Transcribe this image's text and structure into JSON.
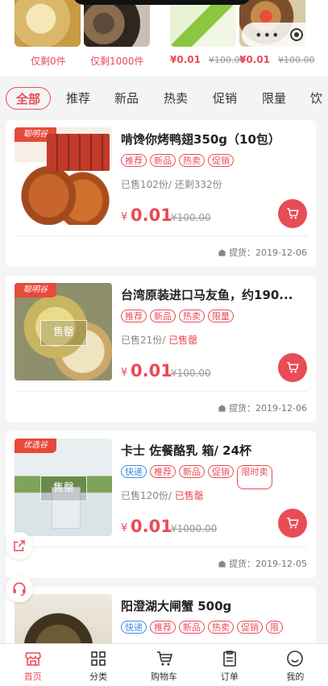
{
  "top_strip": {
    "items": [
      {
        "text": "仅剩0件"
      },
      {
        "text": "仅剩1000件"
      },
      {
        "price": "¥0.01",
        "orig": "¥100.00"
      },
      {
        "price": "¥0.01",
        "orig": "¥100.00"
      }
    ]
  },
  "tabs": [
    "全部",
    "推荐",
    "新品",
    "热卖",
    "促销",
    "限量",
    "饮"
  ],
  "products": [
    {
      "badge": "聪明谷",
      "name": "啃馋你烤鸭翅350g（10包）",
      "tags": [
        "推荐",
        "新品",
        "热卖",
        "促销"
      ],
      "sold": "已售102份/ 还剩332份",
      "price_symbol": "¥",
      "price": "0.01",
      "orig_price": "¥100.00",
      "pickup": "提货：2019-12-06"
    },
    {
      "badge": "聪明谷",
      "overlay": "售罄",
      "name": "台湾原装进口马友鱼，约190...",
      "tags": [
        "推荐",
        "新品",
        "热卖",
        "限量"
      ],
      "sold_prefix": "已售21份/ ",
      "sold_status": "已售罄",
      "price_symbol": "¥",
      "price": "0.01",
      "orig_price": "¥100.00",
      "pickup": "提货：2019-12-06"
    },
    {
      "badge": "优选谷",
      "overlay": "售罄",
      "name": "卡士 佐餐酪乳 箱/ 24杯",
      "tags": [
        "快递",
        "推荐",
        "新品",
        "促销",
        "限时卖"
      ],
      "sold_prefix": "已售120份/ ",
      "sold_status": "已售罄",
      "price_symbol": "¥",
      "price": "0.01",
      "orig_price": "¥1000.00",
      "pickup": "提货：2019-12-05"
    },
    {
      "name": "阳澄湖大闸蟹 500g",
      "tags": [
        "快递",
        "推荐",
        "新品",
        "热卖",
        "促销",
        "限"
      ]
    }
  ],
  "bottom_nav": [
    {
      "label": "首页",
      "icon": "home-icon"
    },
    {
      "label": "分类",
      "icon": "category-icon"
    },
    {
      "label": "购物车",
      "icon": "cart-icon"
    },
    {
      "label": "订单",
      "icon": "order-icon"
    },
    {
      "label": "我的",
      "icon": "profile-icon"
    }
  ],
  "colors": {
    "accent": "#ea4a57",
    "blue_tag": "#3b8de0"
  }
}
